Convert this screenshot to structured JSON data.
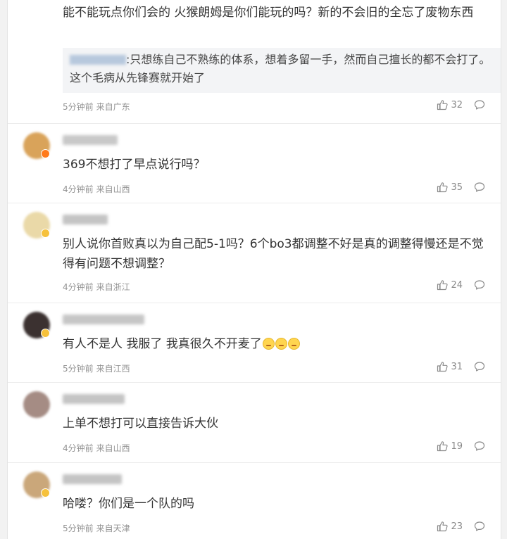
{
  "comments": [
    {
      "text": "能不能玩点你们会的 火猴朗姆是你们能玩的吗？新的不会旧的全忘了废物东西",
      "quote": {
        "author": "",
        "text": ":只想练自己不熟练的体系，想着多留一手，然而自己擅长的都不会打了。这个毛病从先锋赛就开始了"
      },
      "time": "5分钟前",
      "location": "来自广东",
      "likes": "32",
      "avatar_color": "#c9b59a"
    },
    {
      "text": "369不想打了早点说行吗？",
      "time": "4分钟前",
      "location": "来自山西",
      "likes": "35",
      "avatar_color": "#d9a35a",
      "badge": "orange"
    },
    {
      "text": "别人说你首败真以为自己配5-1吗？6个bo3都调整不好是真的调整得慢还是不觉得有问题不想调整？",
      "time": "4分钟前",
      "location": "来自浙江",
      "likes": "24",
      "avatar_color": "#ead9a8",
      "badge": "gold"
    },
    {
      "text": "有人不是人 我服了 我真很久不开麦了",
      "emoji_count": 3,
      "time": "5分钟前",
      "location": "来自江西",
      "likes": "31",
      "avatar_color": "#3b3130",
      "badge": "gold"
    },
    {
      "text": "上单不想打可以直接告诉大伙",
      "time": "4分钟前",
      "location": "来自山西",
      "likes": "19",
      "avatar_color": "#a58c84"
    },
    {
      "text": "哈喽？你们是一个队的吗",
      "time": "5分钟前",
      "location": "来自天津",
      "likes": "23",
      "avatar_color": "#caa77a",
      "badge": "gold"
    }
  ]
}
